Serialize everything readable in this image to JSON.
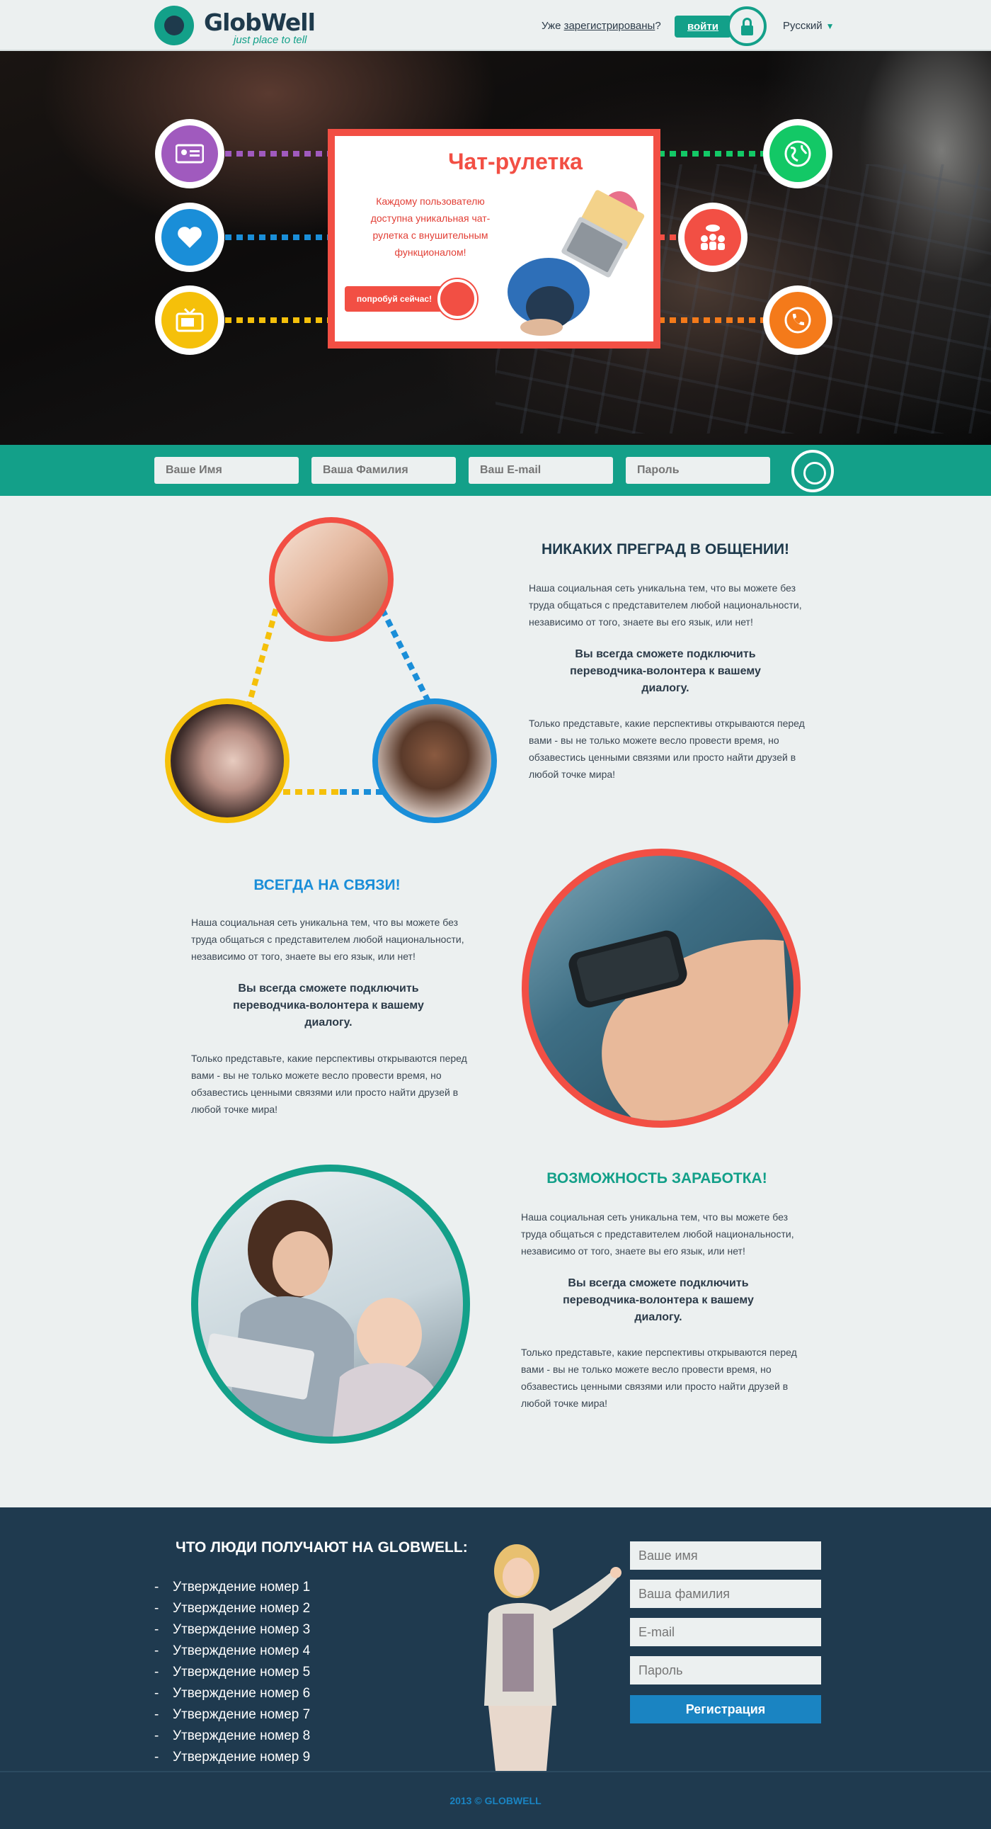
{
  "header": {
    "logo_name": "GlobWell",
    "logo_tagline": "just place to tell",
    "registered_prefix": "Уже ",
    "registered_link": "зарегистрированы",
    "registered_suffix": "?",
    "login_label": "войти",
    "language": "Русский"
  },
  "hero": {
    "card_title": "Чат-рулетка",
    "card_text": "Каждому пользователю доступна уникальная чат-рулетка с внушительным функционалом!",
    "cta_label": "попробуй сейчас!",
    "circle_colors": {
      "purple": "#a05abe",
      "blue": "#1a8ed8",
      "yellow": "#f5c00a",
      "green": "#13c866",
      "red": "#f24f44",
      "orange": "#f47a1a"
    },
    "icons_left": [
      "id-card-icon",
      "heart-icon",
      "tv-icon"
    ],
    "icons_right": [
      "globe-icon",
      "group-chat-icon",
      "phone-icon"
    ]
  },
  "quick_form": {
    "first_name_placeholder": "Ваше Имя",
    "last_name_placeholder": "Ваша Фамилия",
    "email_placeholder": "Ваш E-mail",
    "password_placeholder": "Пароль"
  },
  "features": [
    {
      "title": "НИКАКИХ ПРЕГРАД В ОБЩЕНИИ!",
      "title_color": "#1e3a4c",
      "text1": "Наша социальная сеть уникальна тем, что вы можете без труда общаться с представителем любой национальности, независимо от того, знаете вы его язык, или нет!",
      "subhead": "Вы всегда сможете подключить переводчика-волонтера к вашему диалогу.",
      "text2": "Только представьте, какие перспективы открываются перед вами - вы не только можете весло провести время, но обзавестись ценными связями или просто найти друзей в любой точке мира!"
    },
    {
      "title": "ВСЕГДА НА СВЯЗИ!",
      "title_color": "#1a8ed8",
      "text1": "Наша социальная сеть уникальна тем, что вы можете без труда общаться с представителем любой национальности, независимо от того, знаете вы его язык, или нет!",
      "subhead": "Вы всегда сможете подключить переводчика-волонтера к вашему диалогу.",
      "text2": "Только представьте, какие перспективы открываются перед вами - вы не только можете весло провести время, но обзавестись ценными связями или просто найти друзей в любой точке мира!"
    },
    {
      "title": "ВОЗМОЖНОСТЬ ЗАРАБОТКА!",
      "title_color": "#13a089",
      "text1": "Наша социальная сеть уникальна тем, что вы можете без труда общаться с представителем любой национальности, независимо от того, знаете вы его язык, или нет!",
      "subhead": "Вы всегда сможете подключить переводчика-волонтера к вашему диалогу.",
      "text2": "Только представьте, какие перспективы открываются перед вами - вы не только можете весло провести время, но обзавестись ценными связями или просто найти друзей в любой точке мира!"
    }
  ],
  "benefits": {
    "title": "ЧТО ЛЮДИ ПОЛУЧАЮТ НА GLOBWELL:",
    "items": [
      "Утверждение номер 1",
      "Утверждение номер 2",
      "Утверждение номер 3",
      "Утверждение номер 4",
      "Утверждение номер 5",
      "Утверждение номер 6",
      "Утверждение номер 7",
      "Утверждение номер 8",
      "Утверждение номер 9"
    ]
  },
  "signup": {
    "first_name_placeholder": "Ваше имя",
    "last_name_placeholder": "Ваша фамилия",
    "email_placeholder": "E-mail",
    "password_placeholder": "Пароль",
    "submit_label": "Регистрация"
  },
  "footer": {
    "copyright": "2013 © GLOBWELL"
  }
}
